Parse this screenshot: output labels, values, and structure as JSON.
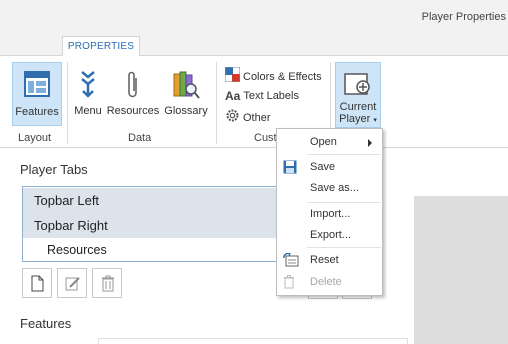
{
  "window": {
    "title": "Player Properties"
  },
  "ribbon_tabs": [
    {
      "label": "PROPERTIES"
    }
  ],
  "ribbon": {
    "layout": {
      "features_label": "Features",
      "group_label": "Layout"
    },
    "data": {
      "menu_label": "Menu",
      "resources_label": "Resources",
      "glossary_label": "Glossary",
      "group_label": "Data"
    },
    "customize": {
      "colors_effects_label": "Colors & Effects",
      "text_labels_label": "Text Labels",
      "text_labels_icon_text": "Aa",
      "other_label": "Other",
      "group_label_partial": "Cust"
    },
    "current_player": {
      "line1": "Current",
      "line2": "Player"
    }
  },
  "player_tabs": {
    "title": "Player Tabs",
    "items": [
      {
        "label": "Topbar Left"
      },
      {
        "label": "Topbar Right"
      },
      {
        "label": "Resources"
      }
    ]
  },
  "features_title": "Features",
  "context_menu": {
    "items": [
      {
        "label": "Open",
        "submenu": true,
        "enabled": true
      },
      {
        "label": "Save",
        "enabled": true
      },
      {
        "label": "Save as...",
        "enabled": true
      },
      {
        "label": "Import...",
        "enabled": true
      },
      {
        "label": "Export...",
        "enabled": true
      },
      {
        "label": "Reset",
        "enabled": true
      },
      {
        "label": "Delete",
        "enabled": false
      }
    ]
  },
  "colors": {
    "accent": "#2b6cb0",
    "active_button_bg": "#cde5f7",
    "selected_row_bg": "#dde3ea"
  }
}
